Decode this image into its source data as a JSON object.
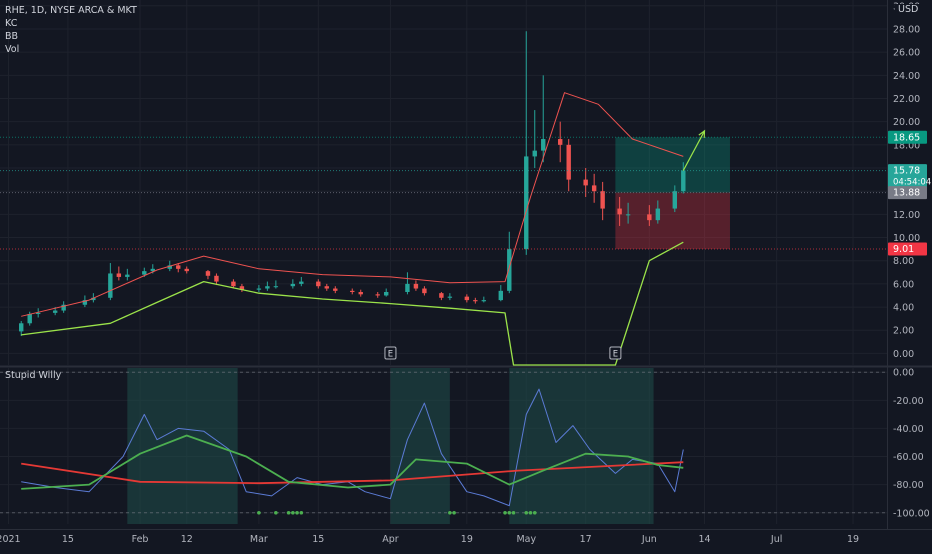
{
  "header": {
    "symbol_line": "RHE, 1D, NYSE ARCA & MKT",
    "indicators": [
      "KC",
      "BB",
      "Vol"
    ],
    "currency": "USD"
  },
  "price_pane": {
    "y_ticks": [
      0,
      2,
      4,
      6,
      8,
      10,
      12,
      14,
      16,
      18,
      20,
      22,
      24,
      26,
      28,
      30
    ],
    "y_tick_labels": [
      "0.00",
      "2.00",
      "4.00",
      "6.00",
      "8.00",
      "10.00",
      "12.00",
      "14.00",
      "16.00",
      "18.00",
      "20.00",
      "22.00",
      "24.00",
      "26.00",
      "28.00",
      "30.00"
    ],
    "ylim": [
      -1,
      30.5
    ],
    "labels": {
      "target": {
        "value": 18.65,
        "text": "18.65",
        "color": "#089981"
      },
      "last": {
        "value": 15.78,
        "text": "15.78",
        "countdown": "04:54:04",
        "color": "#26a69a"
      },
      "entry": {
        "value": 13.88,
        "text": "13.88",
        "color": "#787b86"
      },
      "stop": {
        "value": 9.01,
        "text": "9.01",
        "color": "#f23645"
      }
    },
    "earnings_marker_text": "E",
    "earnings_marker_dates": [
      "2021-04-01",
      "2021-05-24"
    ]
  },
  "indicator_pane": {
    "title": "Stupid Willy",
    "y_ticks": [
      0,
      -20,
      -40,
      -60,
      -80,
      -100
    ],
    "y_tick_labels": [
      "0.00",
      "-20.00",
      "-40.00",
      "-60.00",
      "-80.00",
      "-100.00"
    ],
    "ylim": [
      -108,
      3
    ]
  },
  "x_axis": {
    "ticks": [
      {
        "date": "2021-01-01",
        "label": "2021"
      },
      {
        "date": "2021-01-15",
        "label": "15"
      },
      {
        "date": "2021-02-01",
        "label": "Feb"
      },
      {
        "date": "2021-02-12",
        "label": "12"
      },
      {
        "date": "2021-03-01",
        "label": "Mar"
      },
      {
        "date": "2021-03-15",
        "label": "15"
      },
      {
        "date": "2021-04-01",
        "label": "Apr"
      },
      {
        "date": "2021-04-19",
        "label": "19"
      },
      {
        "date": "2021-05-03",
        "label": "May"
      },
      {
        "date": "2021-05-17",
        "label": "17"
      },
      {
        "date": "2021-06-01",
        "label": "Jun"
      },
      {
        "date": "2021-06-14",
        "label": "14"
      },
      {
        "date": "2021-07-01",
        "label": "Jul"
      },
      {
        "date": "2021-07-19",
        "label": "19"
      }
    ],
    "xlim": [
      "2020-12-30",
      "2021-07-27"
    ]
  },
  "colors": {
    "up": "#26a69a",
    "down": "#ef5350",
    "kc_upper": "#ef5350",
    "bb_lower": "#9be34a",
    "willy": "#5b7bd5",
    "willy_signal": "#4caf50",
    "willy_long": "#e53935",
    "shade": "#1f4f4a",
    "dots": "#4caf50"
  },
  "chart_data": [
    {
      "type": "candlestick",
      "series": [
        {
          "name": "RHE",
          "x": [
            "2021-01-04",
            "2021-01-06",
            "2021-01-08",
            "2021-01-12",
            "2021-01-14",
            "2021-01-19",
            "2021-01-21",
            "2021-01-25",
            "2021-01-27",
            "2021-01-29",
            "2021-02-02",
            "2021-02-04",
            "2021-02-08",
            "2021-02-10",
            "2021-02-12",
            "2021-02-17",
            "2021-02-19",
            "2021-02-23",
            "2021-02-25",
            "2021-03-01",
            "2021-03-03",
            "2021-03-05",
            "2021-03-09",
            "2021-03-11",
            "2021-03-15",
            "2021-03-17",
            "2021-03-19",
            "2021-03-23",
            "2021-03-25",
            "2021-03-29",
            "2021-03-31",
            "2021-04-05",
            "2021-04-07",
            "2021-04-09",
            "2021-04-13",
            "2021-04-15",
            "2021-04-19",
            "2021-04-21",
            "2021-04-23",
            "2021-04-27",
            "2021-04-29",
            "2021-05-03",
            "2021-05-05",
            "2021-05-07",
            "2021-05-11",
            "2021-05-13",
            "2021-05-17",
            "2021-05-19",
            "2021-05-21",
            "2021-05-25",
            "2021-05-27",
            "2021-06-01",
            "2021-06-03",
            "2021-06-07",
            "2021-06-09"
          ],
          "open": [
            1.9,
            2.6,
            3.4,
            3.5,
            3.7,
            4.2,
            4.6,
            4.8,
            6.9,
            6.6,
            6.8,
            7.1,
            7.3,
            7.6,
            7.3,
            7.1,
            6.7,
            6.2,
            5.8,
            5.5,
            5.6,
            5.8,
            5.8,
            6.0,
            6.2,
            5.8,
            5.6,
            5.4,
            5.3,
            5.1,
            5.0,
            5.3,
            6.0,
            5.6,
            5.2,
            4.8,
            4.9,
            4.6,
            4.5,
            4.6,
            5.4,
            9.0,
            17.0,
            17.5,
            18.5,
            18.0,
            15.0,
            14.5,
            14.0,
            12.5,
            12.0,
            12.0,
            11.5,
            12.5,
            14.0
          ],
          "close": [
            2.6,
            3.4,
            3.5,
            3.7,
            4.2,
            4.6,
            4.8,
            6.9,
            6.6,
            6.8,
            7.1,
            7.3,
            7.6,
            7.3,
            7.1,
            6.7,
            6.2,
            5.8,
            5.5,
            5.6,
            5.8,
            5.8,
            6.0,
            6.2,
            5.8,
            5.6,
            5.4,
            5.3,
            5.1,
            5.0,
            5.3,
            6.0,
            5.6,
            5.2,
            4.8,
            4.9,
            4.6,
            4.5,
            4.6,
            5.4,
            9.0,
            17.0,
            17.5,
            18.5,
            18.0,
            15.0,
            14.5,
            14.0,
            12.5,
            12.0,
            12.0,
            11.5,
            12.5,
            14.0,
            15.78
          ],
          "high": [
            2.8,
            3.6,
            3.9,
            4.0,
            4.5,
            5.0,
            5.2,
            7.8,
            7.5,
            7.3,
            7.4,
            7.7,
            8.0,
            7.8,
            7.5,
            7.2,
            6.9,
            6.4,
            6.0,
            5.9,
            6.2,
            6.3,
            6.4,
            6.6,
            6.4,
            6.0,
            5.8,
            5.6,
            5.5,
            5.3,
            5.6,
            7.0,
            6.3,
            5.8,
            5.3,
            5.2,
            5.1,
            4.8,
            4.9,
            5.9,
            10.5,
            27.8,
            21.0,
            24.0,
            20.0,
            18.5,
            16.0,
            15.5,
            14.8,
            13.5,
            13.0,
            12.8,
            13.2,
            14.5,
            16.5
          ],
          "low": [
            1.5,
            2.4,
            3.1,
            3.3,
            3.5,
            4.0,
            4.4,
            4.6,
            6.3,
            6.3,
            6.6,
            6.9,
            7.1,
            7.0,
            6.9,
            6.4,
            5.9,
            5.6,
            5.3,
            5.3,
            5.4,
            5.6,
            5.6,
            5.8,
            5.6,
            5.4,
            5.2,
            5.1,
            4.9,
            4.8,
            4.9,
            5.1,
            5.4,
            5.0,
            4.6,
            4.6,
            4.4,
            4.3,
            4.4,
            4.5,
            5.2,
            8.5,
            16.0,
            16.5,
            16.5,
            14.0,
            13.5,
            13.0,
            11.5,
            11.0,
            11.2,
            11.0,
            11.2,
            12.2,
            13.8
          ]
        },
        {
          "name": "KC upper",
          "x": [
            "2021-01-04",
            "2021-01-20",
            "2021-02-05",
            "2021-02-16",
            "2021-03-01",
            "2021-03-16",
            "2021-04-01",
            "2021-04-15",
            "2021-04-28",
            "2021-05-04",
            "2021-05-12",
            "2021-05-20",
            "2021-05-28",
            "2021-06-09"
          ],
          "y": [
            3.2,
            4.6,
            7.2,
            8.4,
            7.3,
            6.8,
            6.6,
            6.1,
            6.2,
            13.5,
            22.5,
            21.5,
            18.5,
            17.0
          ]
        },
        {
          "name": "BB lower",
          "x": [
            "2021-01-04",
            "2021-01-25",
            "2021-02-05",
            "2021-02-16",
            "2021-03-01",
            "2021-03-16",
            "2021-04-01",
            "2021-04-15",
            "2021-04-28",
            "2021-04-30",
            "2021-05-04",
            "2021-05-24",
            "2021-06-01",
            "2021-06-09"
          ],
          "y": [
            1.6,
            2.6,
            4.4,
            6.2,
            5.2,
            4.7,
            4.3,
            3.9,
            3.5,
            -1.0,
            -1.0,
            -1.0,
            8.0,
            9.6
          ]
        }
      ],
      "annotations": {
        "long_position": {
          "start": "2021-05-24",
          "end": "2021-06-20",
          "entry": 13.88,
          "target": 18.65,
          "stop": 9.01
        },
        "arrow": {
          "from": [
            "2021-06-09",
            15.78
          ],
          "to": [
            "2021-06-14",
            19.2
          ]
        }
      }
    },
    {
      "type": "line",
      "series": [
        {
          "name": "Stupid Willy",
          "x": [
            "2021-01-04",
            "2021-01-12",
            "2021-01-20",
            "2021-01-28",
            "2021-02-02",
            "2021-02-05",
            "2021-02-10",
            "2021-02-16",
            "2021-02-22",
            "2021-02-26",
            "2021-03-04",
            "2021-03-10",
            "2021-03-16",
            "2021-03-22",
            "2021-03-26",
            "2021-04-01",
            "2021-04-05",
            "2021-04-09",
            "2021-04-13",
            "2021-04-19",
            "2021-04-23",
            "2021-04-29",
            "2021-05-03",
            "2021-05-06",
            "2021-05-10",
            "2021-05-14",
            "2021-05-18",
            "2021-05-24",
            "2021-05-28",
            "2021-06-03",
            "2021-06-07",
            "2021-06-09"
          ],
          "y": [
            -78,
            -82,
            -85,
            -60,
            -30,
            -48,
            -40,
            -42,
            -55,
            -85,
            -88,
            -75,
            -80,
            -78,
            -85,
            -90,
            -48,
            -22,
            -58,
            -85,
            -88,
            -95,
            -30,
            -12,
            -50,
            -38,
            -55,
            -72,
            -62,
            -65,
            -85,
            -55
          ]
        },
        {
          "name": "Signal",
          "x": [
            "2021-01-04",
            "2021-01-20",
            "2021-02-01",
            "2021-02-12",
            "2021-02-26",
            "2021-03-08",
            "2021-03-22",
            "2021-04-01",
            "2021-04-07",
            "2021-04-19",
            "2021-04-29",
            "2021-05-07",
            "2021-05-17",
            "2021-05-27",
            "2021-06-03",
            "2021-06-09"
          ],
          "y": [
            -83,
            -80,
            -58,
            -45,
            -60,
            -78,
            -82,
            -80,
            -62,
            -65,
            -80,
            -70,
            -58,
            -60,
            -66,
            -68
          ]
        },
        {
          "name": "Long",
          "x": [
            "2021-01-04",
            "2021-02-01",
            "2021-03-01",
            "2021-04-01",
            "2021-05-01",
            "2021-06-09"
          ],
          "y": [
            -65,
            -78,
            -79,
            -77,
            -70,
            -64
          ]
        }
      ],
      "shaded_ranges": [
        [
          "2021-01-29",
          "2021-02-24"
        ],
        [
          "2021-04-01",
          "2021-04-15"
        ],
        [
          "2021-04-29",
          "2021-06-02"
        ]
      ],
      "signal_dots": [
        "2021-03-01",
        "2021-03-05",
        "2021-03-08",
        "2021-03-09",
        "2021-03-10",
        "2021-03-11",
        "2021-04-15",
        "2021-04-16",
        "2021-04-28",
        "2021-04-29",
        "2021-04-30",
        "2021-05-03",
        "2021-05-04",
        "2021-05-05"
      ],
      "hlines": [
        0,
        -100
      ]
    }
  ]
}
